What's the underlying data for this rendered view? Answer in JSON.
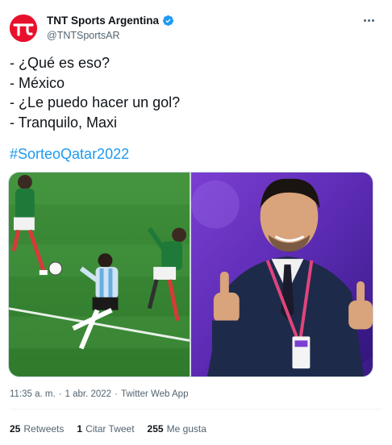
{
  "account": {
    "display_name": "TNT Sports Argentina",
    "handle": "@TNTSportsAR",
    "avatar_icon": "tnt-sports-logo-icon",
    "verified_icon": "verified-badge-icon",
    "more_icon": "more-options-icon",
    "brand_color": "#e8112d"
  },
  "tweet": {
    "lines": [
      "- ¿Qué es eso?",
      "- México",
      "- ¿Le puedo hacer un gol?",
      "- Tranquilo, Maxi"
    ],
    "hashtag": "#SorteoQatar2022",
    "link_color": "#1d9bf0"
  },
  "media": {
    "left_image": "soccer-match-photo",
    "right_image": "player-thumbs-up-photo"
  },
  "meta": {
    "time": "11:35 a. m.",
    "date": "1 abr. 2022",
    "source": "Twitter Web App",
    "separator": "·"
  },
  "stats": {
    "retweets_count": "25",
    "retweets_label": "Retweets",
    "quotes_count": "1",
    "quotes_label": "Citar Tweet",
    "likes_count": "255",
    "likes_label": "Me gusta"
  }
}
